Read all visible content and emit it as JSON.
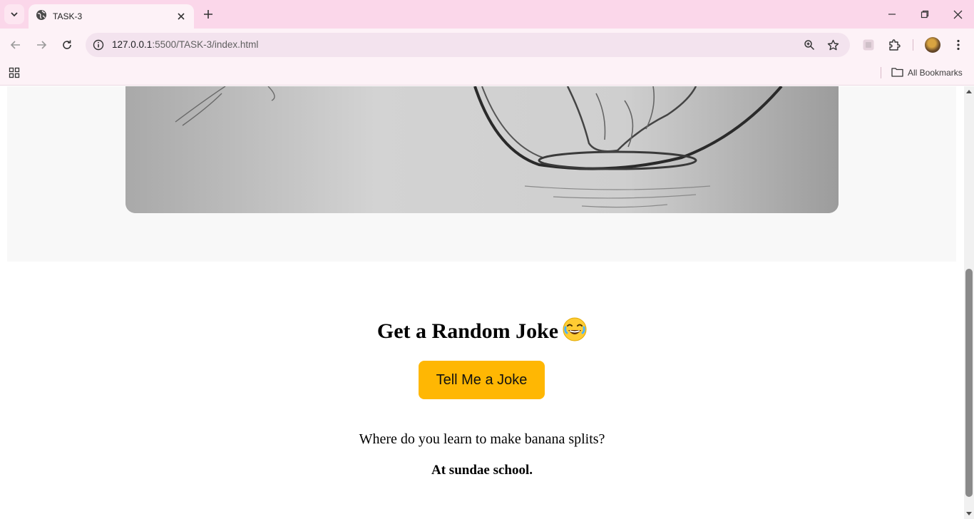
{
  "browser": {
    "tab_title": "TASK-3",
    "url_host": "127.0.0.1",
    "url_path": ":5500/TASK-3/index.html",
    "bookmarks_label": "All Bookmarks"
  },
  "page": {
    "joke_heading": "Get a Random Joke",
    "joke_button": "Tell Me a Joke",
    "joke_setup": "Where do you learn to make banana splits?",
    "joke_punchline": "At sundae school."
  },
  "colors": {
    "tab_strip": "#fbd7ea",
    "toolbar": "#fdf2f7",
    "button_accent": "#ffb703"
  },
  "icons": [
    "tab-search-icon",
    "globe-icon",
    "close-icon",
    "plus-icon",
    "minimize-icon",
    "restore-icon",
    "back-arrow-icon",
    "forward-arrow-icon",
    "reload-icon",
    "site-info-icon",
    "zoom-icon",
    "star-icon",
    "extension-icon",
    "puzzle-icon",
    "kebab-menu-icon",
    "apps-grid-icon",
    "folder-icon",
    "laughing-emoji-icon"
  ]
}
